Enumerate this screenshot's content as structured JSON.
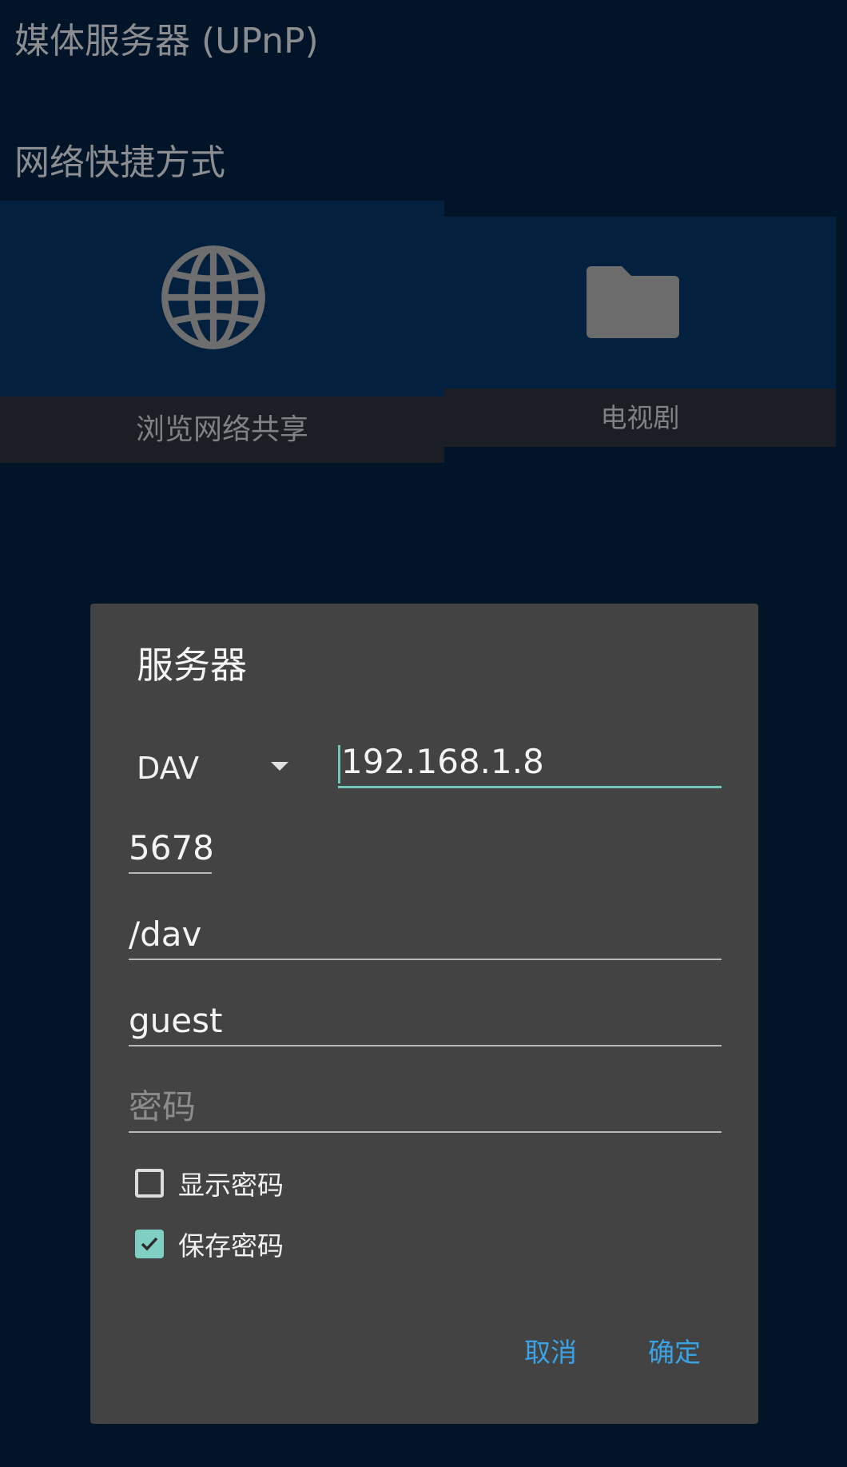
{
  "sections": {
    "media_server": "媒体服务器 (UPnP)",
    "network_shortcuts": "网络快捷方式"
  },
  "tiles": [
    {
      "label": "浏览网络共享",
      "icon": "globe-icon"
    },
    {
      "label": "电视剧",
      "icon": "folder-icon"
    }
  ],
  "dialog": {
    "title": "服务器",
    "protocol": "DAV",
    "host": "192.168.1.8",
    "port": "5678",
    "path": "/dav",
    "username": "guest",
    "password_placeholder": "密码",
    "show_password": {
      "label": "显示密码",
      "checked": false
    },
    "save_password": {
      "label": "保存密码",
      "checked": true
    },
    "cancel": "取消",
    "ok": "确定"
  },
  "colors": {
    "background": "#011428",
    "tile": "#03213f",
    "dialog": "#434343",
    "accent": "#6fc8b7",
    "button_text": "#3aa3e7"
  }
}
